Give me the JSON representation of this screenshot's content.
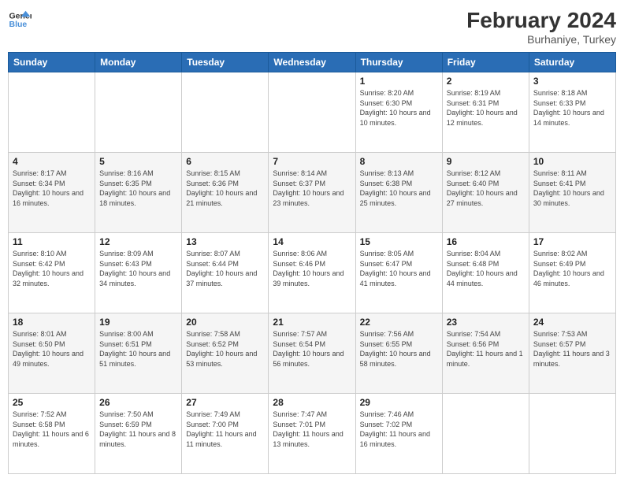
{
  "header": {
    "logo_line1": "General",
    "logo_line2": "Blue",
    "title": "February 2024",
    "subtitle": "Burhaniye, Turkey"
  },
  "days_of_week": [
    "Sunday",
    "Monday",
    "Tuesday",
    "Wednesday",
    "Thursday",
    "Friday",
    "Saturday"
  ],
  "weeks": [
    [
      {
        "day": "",
        "info": ""
      },
      {
        "day": "",
        "info": ""
      },
      {
        "day": "",
        "info": ""
      },
      {
        "day": "",
        "info": ""
      },
      {
        "day": "1",
        "info": "Sunrise: 8:20 AM\nSunset: 6:30 PM\nDaylight: 10 hours\nand 10 minutes."
      },
      {
        "day": "2",
        "info": "Sunrise: 8:19 AM\nSunset: 6:31 PM\nDaylight: 10 hours\nand 12 minutes."
      },
      {
        "day": "3",
        "info": "Sunrise: 8:18 AM\nSunset: 6:33 PM\nDaylight: 10 hours\nand 14 minutes."
      }
    ],
    [
      {
        "day": "4",
        "info": "Sunrise: 8:17 AM\nSunset: 6:34 PM\nDaylight: 10 hours\nand 16 minutes."
      },
      {
        "day": "5",
        "info": "Sunrise: 8:16 AM\nSunset: 6:35 PM\nDaylight: 10 hours\nand 18 minutes."
      },
      {
        "day": "6",
        "info": "Sunrise: 8:15 AM\nSunset: 6:36 PM\nDaylight: 10 hours\nand 21 minutes."
      },
      {
        "day": "7",
        "info": "Sunrise: 8:14 AM\nSunset: 6:37 PM\nDaylight: 10 hours\nand 23 minutes."
      },
      {
        "day": "8",
        "info": "Sunrise: 8:13 AM\nSunset: 6:38 PM\nDaylight: 10 hours\nand 25 minutes."
      },
      {
        "day": "9",
        "info": "Sunrise: 8:12 AM\nSunset: 6:40 PM\nDaylight: 10 hours\nand 27 minutes."
      },
      {
        "day": "10",
        "info": "Sunrise: 8:11 AM\nSunset: 6:41 PM\nDaylight: 10 hours\nand 30 minutes."
      }
    ],
    [
      {
        "day": "11",
        "info": "Sunrise: 8:10 AM\nSunset: 6:42 PM\nDaylight: 10 hours\nand 32 minutes."
      },
      {
        "day": "12",
        "info": "Sunrise: 8:09 AM\nSunset: 6:43 PM\nDaylight: 10 hours\nand 34 minutes."
      },
      {
        "day": "13",
        "info": "Sunrise: 8:07 AM\nSunset: 6:44 PM\nDaylight: 10 hours\nand 37 minutes."
      },
      {
        "day": "14",
        "info": "Sunrise: 8:06 AM\nSunset: 6:46 PM\nDaylight: 10 hours\nand 39 minutes."
      },
      {
        "day": "15",
        "info": "Sunrise: 8:05 AM\nSunset: 6:47 PM\nDaylight: 10 hours\nand 41 minutes."
      },
      {
        "day": "16",
        "info": "Sunrise: 8:04 AM\nSunset: 6:48 PM\nDaylight: 10 hours\nand 44 minutes."
      },
      {
        "day": "17",
        "info": "Sunrise: 8:02 AM\nSunset: 6:49 PM\nDaylight: 10 hours\nand 46 minutes."
      }
    ],
    [
      {
        "day": "18",
        "info": "Sunrise: 8:01 AM\nSunset: 6:50 PM\nDaylight: 10 hours\nand 49 minutes."
      },
      {
        "day": "19",
        "info": "Sunrise: 8:00 AM\nSunset: 6:51 PM\nDaylight: 10 hours\nand 51 minutes."
      },
      {
        "day": "20",
        "info": "Sunrise: 7:58 AM\nSunset: 6:52 PM\nDaylight: 10 hours\nand 53 minutes."
      },
      {
        "day": "21",
        "info": "Sunrise: 7:57 AM\nSunset: 6:54 PM\nDaylight: 10 hours\nand 56 minutes."
      },
      {
        "day": "22",
        "info": "Sunrise: 7:56 AM\nSunset: 6:55 PM\nDaylight: 10 hours\nand 58 minutes."
      },
      {
        "day": "23",
        "info": "Sunrise: 7:54 AM\nSunset: 6:56 PM\nDaylight: 11 hours\nand 1 minute."
      },
      {
        "day": "24",
        "info": "Sunrise: 7:53 AM\nSunset: 6:57 PM\nDaylight: 11 hours\nand 3 minutes."
      }
    ],
    [
      {
        "day": "25",
        "info": "Sunrise: 7:52 AM\nSunset: 6:58 PM\nDaylight: 11 hours\nand 6 minutes."
      },
      {
        "day": "26",
        "info": "Sunrise: 7:50 AM\nSunset: 6:59 PM\nDaylight: 11 hours\nand 8 minutes."
      },
      {
        "day": "27",
        "info": "Sunrise: 7:49 AM\nSunset: 7:00 PM\nDaylight: 11 hours\nand 11 minutes."
      },
      {
        "day": "28",
        "info": "Sunrise: 7:47 AM\nSunset: 7:01 PM\nDaylight: 11 hours\nand 13 minutes."
      },
      {
        "day": "29",
        "info": "Sunrise: 7:46 AM\nSunset: 7:02 PM\nDaylight: 11 hours\nand 16 minutes."
      },
      {
        "day": "",
        "info": ""
      },
      {
        "day": "",
        "info": ""
      }
    ]
  ]
}
